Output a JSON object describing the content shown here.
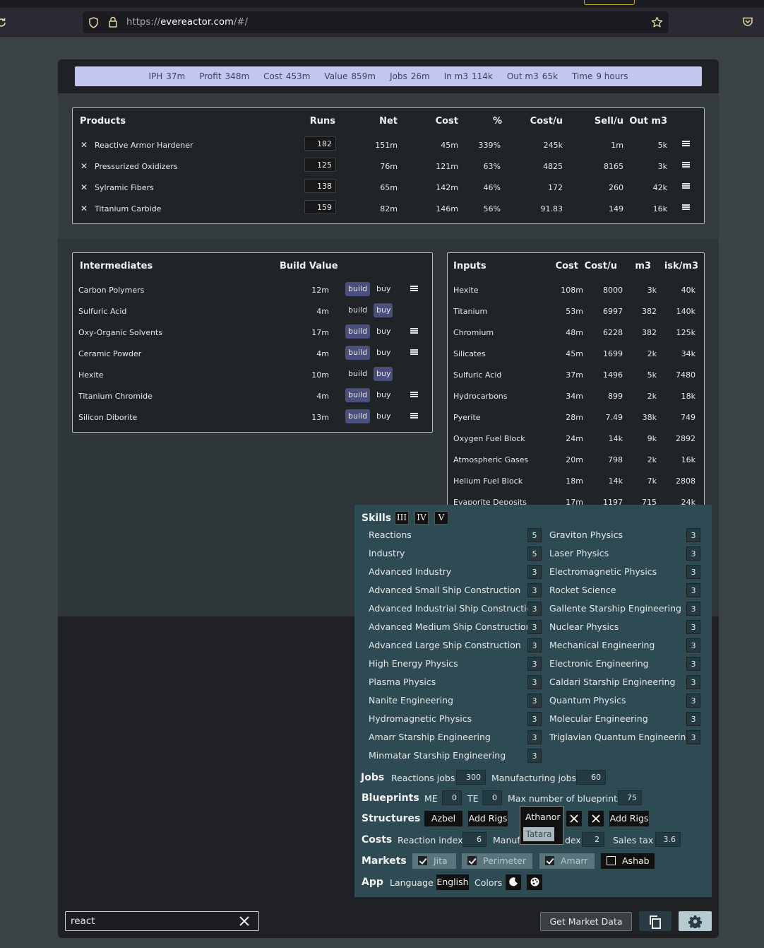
{
  "browser": {
    "url_scheme": "https://",
    "url_host": "evereactor.com",
    "url_path": "/#/"
  },
  "stats": [
    {
      "label": "IPH",
      "value": "37m"
    },
    {
      "label": "Profit",
      "value": "348m"
    },
    {
      "label": "Cost",
      "value": "453m"
    },
    {
      "label": "Value",
      "value": "859m"
    },
    {
      "label": "Jobs",
      "value": "26m"
    },
    {
      "label": "In m3",
      "value": "114k"
    },
    {
      "label": "Out m3",
      "value": "65k"
    },
    {
      "label": "Time",
      "value": "9 hours"
    }
  ],
  "products": {
    "headers": {
      "name": "Products",
      "runs": "Runs",
      "net": "Net",
      "cost": "Cost",
      "pct": "%",
      "costu": "Cost/u",
      "sellu": "Sell/u",
      "outm3": "Out m3"
    },
    "rows": [
      {
        "name": "Reactive Armor Hardener",
        "runs": "182",
        "net": "151m",
        "cost": "45m",
        "pct": "339%",
        "costu": "245k",
        "sellu": "1m",
        "outm3": "5k"
      },
      {
        "name": "Pressurized Oxidizers",
        "runs": "125",
        "net": "76m",
        "cost": "121m",
        "pct": "63%",
        "costu": "4825",
        "sellu": "8165",
        "outm3": "3k"
      },
      {
        "name": "Sylramic Fibers",
        "runs": "138",
        "net": "65m",
        "cost": "142m",
        "pct": "46%",
        "costu": "172",
        "sellu": "260",
        "outm3": "42k"
      },
      {
        "name": "Titanium Carbide",
        "runs": "159",
        "net": "82m",
        "cost": "146m",
        "pct": "56%",
        "costu": "91.83",
        "sellu": "149",
        "outm3": "16k"
      }
    ]
  },
  "intermediates": {
    "headers": {
      "name": "Intermediates",
      "value": "Build Value"
    },
    "build_label": "build",
    "buy_label": "buy",
    "rows": [
      {
        "name": "Carbon Polymers",
        "value": "12m",
        "mode": "build"
      },
      {
        "name": "Sulfuric Acid",
        "value": "4m",
        "mode": "buy"
      },
      {
        "name": "Oxy-Organic Solvents",
        "value": "17m",
        "mode": "build"
      },
      {
        "name": "Ceramic Powder",
        "value": "4m",
        "mode": "build"
      },
      {
        "name": "Hexite",
        "value": "10m",
        "mode": "buy"
      },
      {
        "name": "Titanium Chromide",
        "value": "4m",
        "mode": "build"
      },
      {
        "name": "Silicon Diborite",
        "value": "13m",
        "mode": "build"
      }
    ]
  },
  "inputs": {
    "headers": {
      "name": "Inputs",
      "cost": "Cost",
      "costu": "Cost/u",
      "m3": "m3",
      "iskm3": "isk/m3"
    },
    "rows": [
      {
        "name": "Hexite",
        "cost": "108m",
        "costu": "8000",
        "m3": "3k",
        "iskm3": "40k"
      },
      {
        "name": "Titanium",
        "cost": "53m",
        "costu": "6997",
        "m3": "382",
        "iskm3": "140k"
      },
      {
        "name": "Chromium",
        "cost": "48m",
        "costu": "6228",
        "m3": "382",
        "iskm3": "125k"
      },
      {
        "name": "Silicates",
        "cost": "45m",
        "costu": "1699",
        "m3": "2k",
        "iskm3": "34k"
      },
      {
        "name": "Sulfuric Acid",
        "cost": "37m",
        "costu": "1496",
        "m3": "5k",
        "iskm3": "7480"
      },
      {
        "name": "Hydrocarbons",
        "cost": "34m",
        "costu": "899",
        "m3": "2k",
        "iskm3": "18k"
      },
      {
        "name": "Pyerite",
        "cost": "28m",
        "costu": "7.49",
        "m3": "38k",
        "iskm3": "749"
      },
      {
        "name": "Oxygen Fuel Block",
        "cost": "24m",
        "costu": "14k",
        "m3": "9k",
        "iskm3": "2892"
      },
      {
        "name": "Atmospheric Gases",
        "cost": "20m",
        "costu": "798",
        "m3": "2k",
        "iskm3": "16k"
      },
      {
        "name": "Helium Fuel Block",
        "cost": "18m",
        "costu": "14k",
        "m3": "7k",
        "iskm3": "2808"
      },
      {
        "name": "Evaporite Deposits",
        "cost": "17m",
        "costu": "1197",
        "m3": "715",
        "iskm3": "24k"
      }
    ]
  },
  "settings": {
    "skills_title": "Skills",
    "roman_buttons": [
      "III",
      "IV",
      "V"
    ],
    "skills_left": [
      {
        "name": "Reactions",
        "level": "5"
      },
      {
        "name": "Industry",
        "level": "5"
      },
      {
        "name": "Advanced Industry",
        "level": "3"
      },
      {
        "name": "Advanced Small Ship Construction",
        "level": "3"
      },
      {
        "name": "Advanced Industrial Ship Construction",
        "level": "3"
      },
      {
        "name": "Advanced Medium Ship Construction",
        "level": "3"
      },
      {
        "name": "Advanced Large Ship Construction",
        "level": "3"
      },
      {
        "name": "High Energy Physics",
        "level": "3"
      },
      {
        "name": "Plasma Physics",
        "level": "3"
      },
      {
        "name": "Nanite Engineering",
        "level": "3"
      },
      {
        "name": "Hydromagnetic Physics",
        "level": "3"
      },
      {
        "name": "Amarr Starship Engineering",
        "level": "3"
      },
      {
        "name": "Minmatar Starship Engineering",
        "level": "3"
      }
    ],
    "skills_right": [
      {
        "name": "Graviton Physics",
        "level": "3"
      },
      {
        "name": "Laser Physics",
        "level": "3"
      },
      {
        "name": "Electromagnetic Physics",
        "level": "3"
      },
      {
        "name": "Rocket Science",
        "level": "3"
      },
      {
        "name": "Gallente Starship Engineering",
        "level": "3"
      },
      {
        "name": "Nuclear Physics",
        "level": "3"
      },
      {
        "name": "Mechanical Engineering",
        "level": "3"
      },
      {
        "name": "Electronic Engineering",
        "level": "3"
      },
      {
        "name": "Caldari Starship Engineering",
        "level": "3"
      },
      {
        "name": "Quantum Physics",
        "level": "3"
      },
      {
        "name": "Molecular Engineering",
        "level": "3"
      },
      {
        "name": "Triglavian Quantum Engineering",
        "level": "3"
      }
    ],
    "jobs": {
      "title": "Jobs",
      "reactions_label": "Reactions jobs",
      "reactions_value": "300",
      "manufacturing_label": "Manufacturing jobs",
      "manufacturing_value": "60"
    },
    "blueprints": {
      "title": "Blueprints",
      "me_label": "ME",
      "me_value": "0",
      "te_label": "TE",
      "te_value": "0",
      "max_label": "Max number of blueprints",
      "max_value": "75"
    },
    "structures": {
      "title": "Structures",
      "s1": "Azbel",
      "add_rigs": "Add Rigs",
      "dropdown_options": [
        "Athanor",
        "Tatara"
      ],
      "add_rigs2": "Add Rigs"
    },
    "costs": {
      "title": "Costs",
      "reaction_index_label": "Reaction index",
      "reaction_index_value": "6",
      "manuf_partial": "Manuf",
      "index_partial": "dex",
      "manuf_index_value": "2",
      "sales_tax_label": "Sales tax",
      "sales_tax_value": "3.6"
    },
    "markets": {
      "title": "Markets",
      "items": [
        {
          "name": "Jita",
          "checked": true
        },
        {
          "name": "Perimeter",
          "checked": true
        },
        {
          "name": "Amarr",
          "checked": true
        },
        {
          "name": "Ashab",
          "checked": false
        }
      ]
    },
    "app": {
      "title": "App",
      "language_label": "Language",
      "language_value": "English",
      "colors_label": "Colors"
    }
  },
  "footer": {
    "search_value": "react",
    "market_button": "Get Market Data"
  }
}
